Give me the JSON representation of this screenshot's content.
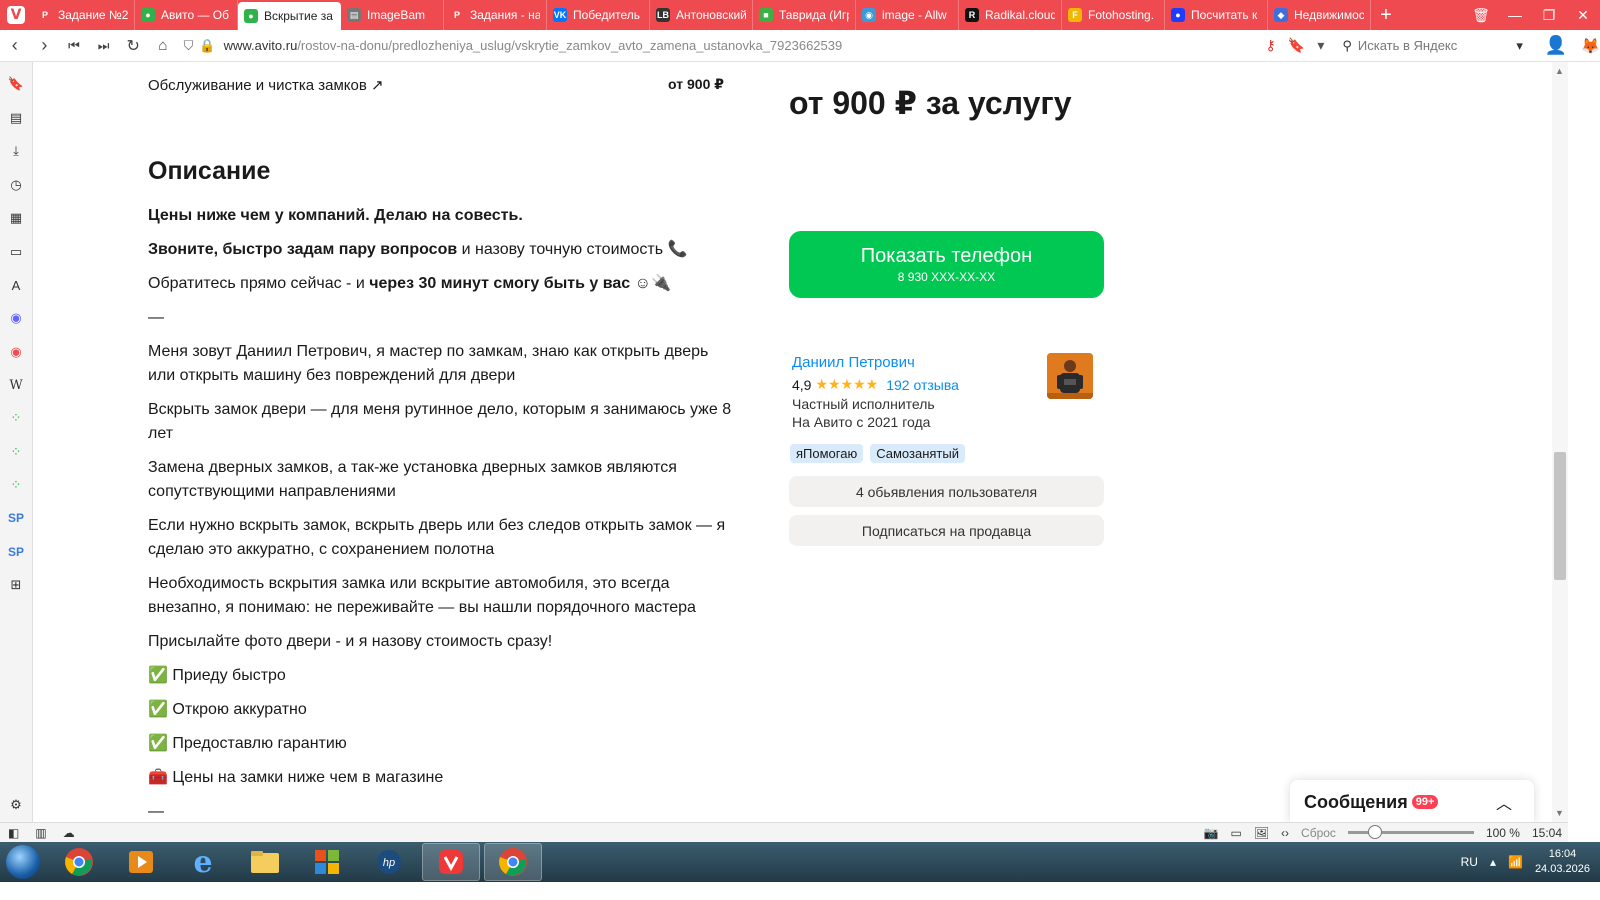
{
  "tabs": [
    {
      "label": "Задание №2",
      "color": "#ef4a4f",
      "glyph": "P"
    },
    {
      "label": "Авито — Об",
      "color": "#2fb24a",
      "glyph": "●"
    },
    {
      "label": "Вскрытие за",
      "color": "#2fb24a",
      "glyph": "●",
      "active": true
    },
    {
      "label": "ImageBam",
      "color": "#777777",
      "glyph": "▤"
    },
    {
      "label": "Задания - на",
      "color": "#ef4a4f",
      "glyph": "P"
    },
    {
      "label": "Победитель",
      "color": "#0077ff",
      "glyph": "VK"
    },
    {
      "label": "Антоновский",
      "color": "#333333",
      "glyph": "LB"
    },
    {
      "label": "Таврида (Игр",
      "color": "#3cb043",
      "glyph": "■"
    },
    {
      "label": "image - Allw",
      "color": "#3b9bd8",
      "glyph": "◉"
    },
    {
      "label": "Radikal.cloud",
      "color": "#111111",
      "glyph": "R"
    },
    {
      "label": "Fotohosting.",
      "color": "#f2b705",
      "glyph": "F"
    },
    {
      "label": "Посчитать к",
      "color": "#1e3cff",
      "glyph": "●"
    },
    {
      "label": "Недвижимос",
      "color": "#3f6fd8",
      "glyph": "◆"
    }
  ],
  "address": {
    "host": "www.avito.ru",
    "path": "/rostov-na-donu/predlozheniya_uslug/vskrytie_zamkov_avto_zamena_ustanovka_7923662539",
    "search_placeholder": "Искать в Яндекс"
  },
  "page": {
    "service_row": {
      "label": "Обслуживание и чистка замков ↗",
      "price": "от 900 ₽"
    },
    "description_title": "Описание",
    "description": [
      {
        "bold": "Цены ниже чем у компаний. Делаю на совесть.",
        "text": ""
      },
      {
        "bold": "Звоните, быстро задам пару вопросов",
        "text": " и назову точную стоимость 📞"
      },
      {
        "pre": "Обратитесь прямо сейчас - и ",
        "bold": "через 30 минут смогу быть у вас",
        "text": " ☺🔌"
      },
      {
        "text": "—"
      },
      {
        "text": "Меня зовут Даниил Петрович, я мастер по замкам, знаю как открыть дверь или открыть машину без повреждений для двери"
      },
      {
        "text": "Вскрыть замок двери — для меня рутинное дело, которым я занимаюсь уже 8 лет"
      },
      {
        "text": "Замена дверных замков, а так-же установка дверных замков являются сопутствующими направлениями"
      },
      {
        "text": "Если нужно вскрыть замок, вскрыть дверь или без следов открыть замок — я сделаю это аккуратно, с сохранением полотна"
      },
      {
        "text": "Необходимость вскрытия замка или вскрытие автомобиля, это всегда внезапно, я понимаю: не переживайте — вы нашли порядочного мастера"
      },
      {
        "text": "Присылайте фото двери - и я назову стоимость сразу!"
      },
      {
        "text": "✅ Приеду быстро"
      },
      {
        "text": "✅ Открою аккуратно"
      },
      {
        "text": "✅ Предоставлю гарантию"
      },
      {
        "text": "🧰 Цены на замки ниже чем в магазине"
      },
      {
        "text": "—"
      }
    ],
    "price_headline": "от 900 ₽ за услугу",
    "phone_button": {
      "label": "Показать телефон",
      "number": "8 930 XXX-XX-XX"
    },
    "seller": {
      "name": "Даниил Петрович",
      "rating": "4,9",
      "stars": "★★★★★",
      "reviews": "192 отзыва",
      "type": "Частный исполнитель",
      "since": "На Авито с 2021 года",
      "badges": [
        "яПомогаю",
        "Самозанятый"
      ]
    },
    "seller_ads_button": "4 обьявления пользователя",
    "subscribe_button": "Подписаться на продавца",
    "messages": {
      "title": "Сообщения",
      "count": "99+"
    }
  },
  "statusbar": {
    "reset": "Сброс",
    "zoom": "100 %",
    "time": "15:04"
  },
  "taskbar": {
    "lang": "RU",
    "time": "16:04",
    "date": "24.03.2026"
  },
  "colors": {
    "accent_red": "#ef4a4f",
    "avito_green": "#00c853",
    "link_blue": "#0a8ff0",
    "star": "#ffb21e"
  }
}
